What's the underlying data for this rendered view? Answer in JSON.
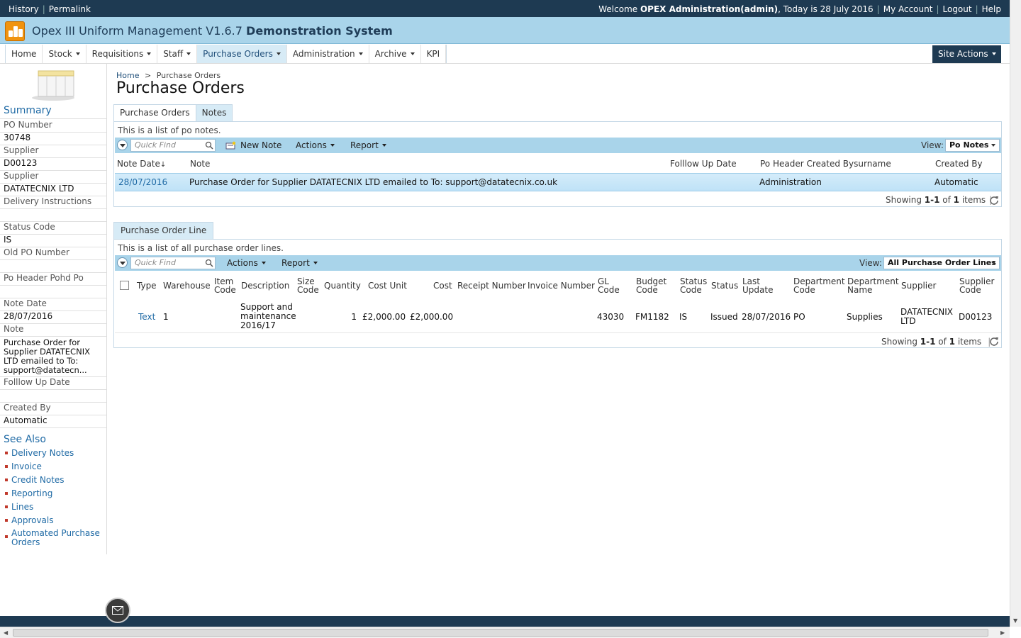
{
  "topbar": {
    "history": "History",
    "permalink": "Permalink",
    "welcome_prefix": "Welcome ",
    "user": "OPEX Administration(admin)",
    "today": ", Today is 28 July 2016",
    "my_account": "My Account",
    "logout": "Logout",
    "help": "Help"
  },
  "header": {
    "title": "Opex III Uniform Management V1.6.7",
    "title_bold": "Demonstration System"
  },
  "nav": {
    "items": [
      {
        "label": "Home"
      },
      {
        "label": "Stock"
      },
      {
        "label": "Requisitions"
      },
      {
        "label": "Staff"
      },
      {
        "label": "Purchase Orders"
      },
      {
        "label": "Administration"
      },
      {
        "label": "Archive"
      },
      {
        "label": "KPI"
      }
    ],
    "site_actions": "Site Actions"
  },
  "breadcrumb": {
    "home": "Home",
    "sep": ">",
    "current": "Purchase Orders"
  },
  "page_title": "Purchase Orders",
  "summary": {
    "heading": "Summary",
    "po_number_label": "PO Number",
    "po_number": "30748",
    "supplier_label": "Supplier",
    "supplier_code": "D00123",
    "supplier_label2": "Supplier",
    "supplier_name": "DATATECNIX LTD",
    "delivery_label": "Delivery Instructions",
    "delivery_value": "",
    "status_code_label": "Status Code",
    "status_code": "IS",
    "old_po_label": "Old PO Number",
    "old_po_value": "",
    "pohd_label": "Po Header Pohd Po",
    "pohd_value": "",
    "note_date_label": "Note Date",
    "note_date": "28/07/2016",
    "note_label": "Note",
    "note_value": "Purchase Order for Supplier DATATECNIX LTD emailed to To: support@datatecn...",
    "followup_label": "Folllow Up Date",
    "followup_value": "",
    "created_by_label": "Created By",
    "created_by": "Automatic"
  },
  "see_also": {
    "heading": "See Also",
    "links": [
      {
        "label": "Delivery Notes"
      },
      {
        "label": "Invoice"
      },
      {
        "label": "Credit Notes"
      },
      {
        "label": "Reporting"
      },
      {
        "label": "Lines"
      },
      {
        "label": "Approvals"
      },
      {
        "label": "Automated Purchase Orders"
      }
    ]
  },
  "notes_section": {
    "tabs": [
      {
        "label": "Purchase Orders"
      },
      {
        "label": "Notes"
      }
    ],
    "description": "This is a list of po notes.",
    "quickfind_placeholder": "Quick Find",
    "new_note": "New Note",
    "actions": "Actions",
    "report": "Report",
    "view_label": "View:",
    "view_value": "Po Notes",
    "columns": {
      "note_date": "Note Date",
      "note": "Note",
      "followup": "Folllow Up Date",
      "created_bysurname": "Po Header Created Bysurname",
      "created_by": "Created By"
    },
    "rows": [
      {
        "note_date": "28/07/2016",
        "note": "Purchase Order for Supplier DATATECNIX LTD emailed to To: support@datatecnix.co.uk",
        "followup": "",
        "created_bysurname": "Administration",
        "created_by": "Automatic"
      }
    ],
    "showing_prefix": "Showing ",
    "showing_range": "1-1",
    "showing_of": " of ",
    "showing_total": "1",
    "showing_suffix": " items"
  },
  "lines_section": {
    "tab": "Purchase Order Line",
    "description": "This is a list of all purchase order lines.",
    "quickfind_placeholder": "Quick Find",
    "actions": "Actions",
    "report": "Report",
    "view_label": "View:",
    "view_value": "All Purchase Order Lines",
    "columns": {
      "type": "Type",
      "warehouse": "Warehouse",
      "item_code": "Item Code",
      "description": "Description",
      "size_code": "Size Code",
      "quantity": "Quantity",
      "cost_unit": "Cost Unit",
      "cost": "Cost",
      "receipt_number": "Receipt Number",
      "invoice_number": "Invoice Number",
      "gl_code": "GL Code",
      "budget_code": "Budget Code",
      "status_code": "Status Code",
      "status": "Status",
      "last_update": "Last Update",
      "department_code": "Department Code",
      "department_name": "Department Name",
      "supplier": "Supplier",
      "supplier_code": "Supplier Code"
    },
    "rows": [
      {
        "type": "Text",
        "warehouse": "1",
        "item_code": "",
        "description": "Support and maintenance 2016/17",
        "size_code": "",
        "quantity": "1",
        "cost_unit": "£2,000.00",
        "cost": "£2,000.00",
        "receipt_number": "",
        "invoice_number": "",
        "gl_code": "43030",
        "budget_code": "FM1182",
        "status_code": "IS",
        "status": "Issued",
        "last_update": "28/07/2016",
        "department_code": "PO",
        "department_name": "Supplies",
        "supplier": "DATATECNIX LTD",
        "supplier_code": "D00123"
      }
    ],
    "showing_prefix": "Showing ",
    "showing_range": "1-1",
    "showing_of": " of ",
    "showing_total": "1",
    "showing_suffix": " items"
  }
}
